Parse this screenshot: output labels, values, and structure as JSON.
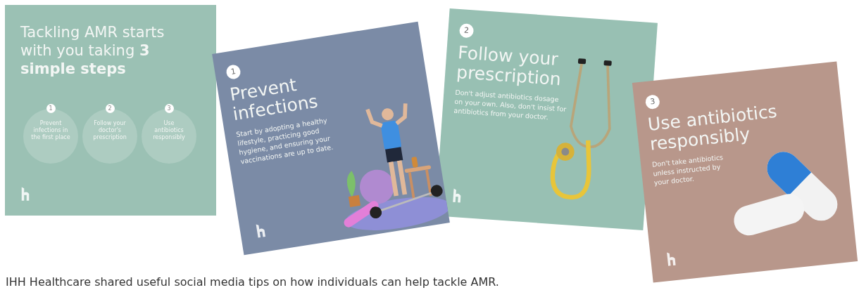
{
  "cards": [
    {
      "kind": "intro",
      "color": "#9bc1b4",
      "title": "Tackling AMR starts with you taking **3 simple steps**",
      "steps": [
        {
          "number": "1",
          "text": "Prevent infections in the first place"
        },
        {
          "number": "2",
          "text": "Follow your doctor's prescription"
        },
        {
          "number": "3",
          "text": "Use antibiotics responsibly"
        }
      ]
    },
    {
      "kind": "step",
      "color": "#7b8ba6",
      "number": "1",
      "title": "Prevent infections",
      "body": "Start by adopting a healthy lifestyle, practicing good hygiene, and ensuring your vaccinations are up to date.",
      "illustration": {
        "kind": "person"
      }
    },
    {
      "kind": "step",
      "color": "#98c0b3",
      "number": "2",
      "title": "Follow your prescription",
      "body": "Don't adjust antibiotics dosage on your own. Also, don't insist for antibiotics from your doctor.",
      "illustration": {
        "kind": "stethoscope"
      }
    },
    {
      "kind": "step",
      "color": "#b8978b",
      "number": "3",
      "title": "Use antibiotics responsibly",
      "body": "Don't take antibiotics unless instructed by your doctor.",
      "illustration": {
        "kind": "capsules"
      }
    }
  ],
  "caption": "IHH Healthcare shared useful social media tips on how individuals can help tackle AMR."
}
